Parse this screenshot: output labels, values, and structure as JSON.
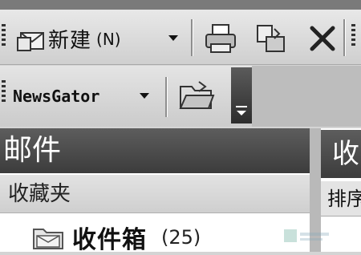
{
  "toolbar_standard": {
    "new_label": "新建",
    "new_accel": "(N)",
    "icons": [
      "new-mail-icon",
      "print-icon",
      "move-to-folder-icon",
      "delete-icon"
    ]
  },
  "toolbar_newsgator": {
    "label": "NewsGator",
    "icons": [
      "open-folder-icon",
      "toolbar-options-icon"
    ]
  },
  "navigation_pane": {
    "header": "邮件",
    "favorites_label": "收藏夹",
    "inbox": {
      "name": "收件箱",
      "count": "(25)"
    }
  },
  "reading_pane": {
    "header": "收",
    "sub_label": "排序"
  }
}
